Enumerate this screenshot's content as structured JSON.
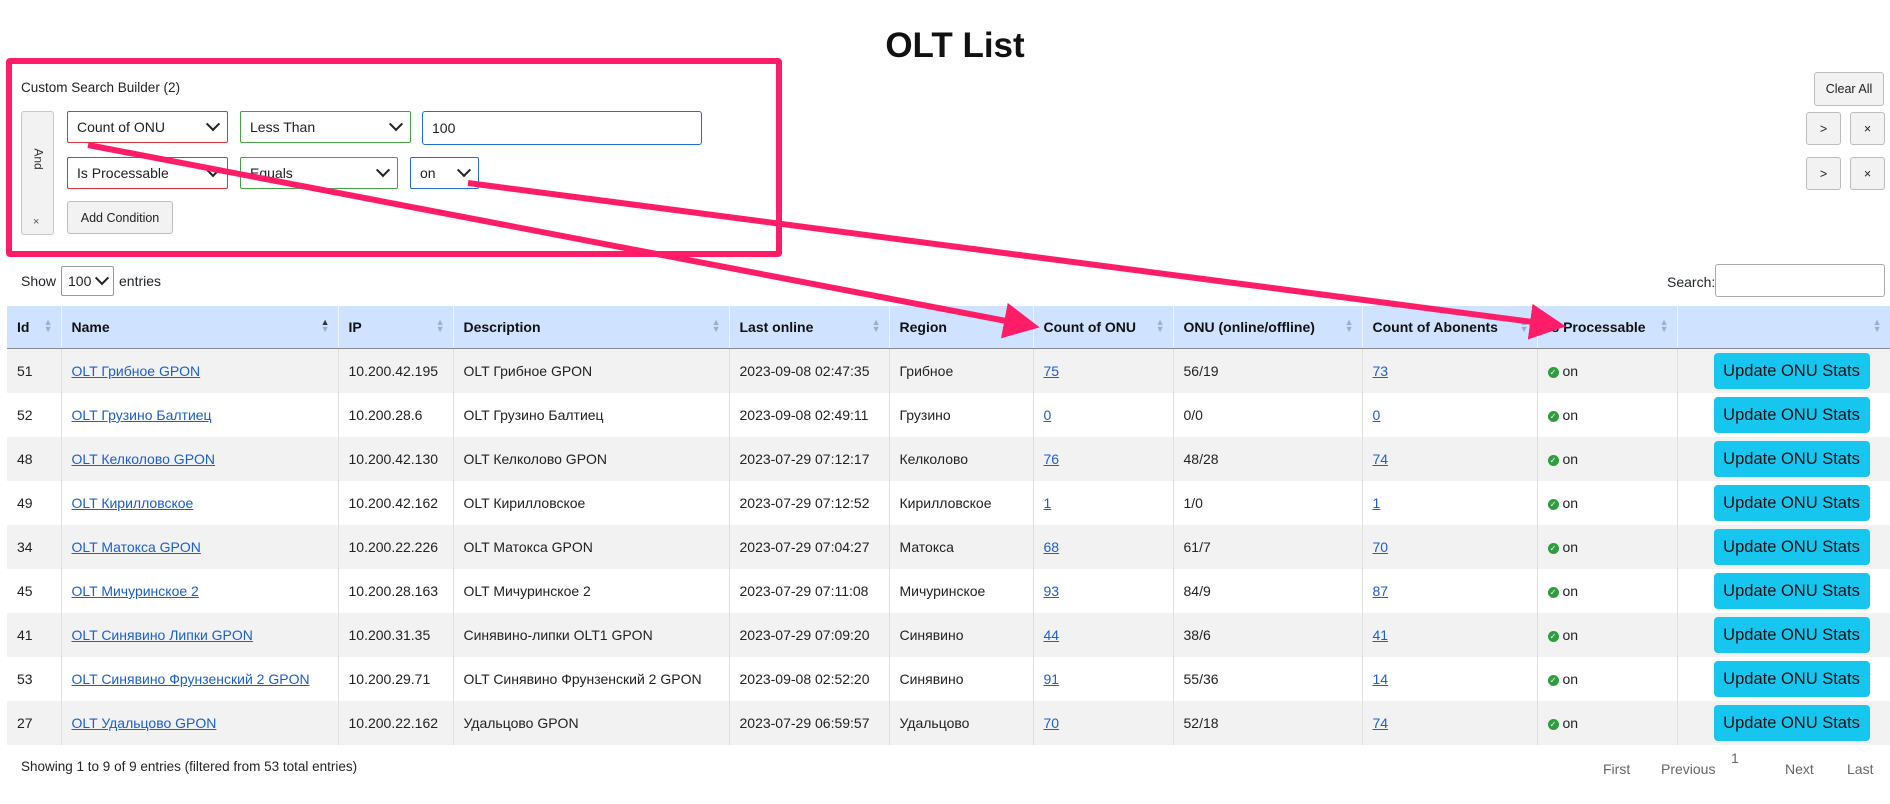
{
  "page": {
    "title": "OLT List"
  },
  "search_builder": {
    "title": "Custom Search Builder (2)",
    "logic": "And",
    "logic_remove": "×",
    "conditions": [
      {
        "column": "Count of ONU",
        "operator": "Less Than",
        "value": "100"
      },
      {
        "column": "Is Processable",
        "operator": "Equals",
        "value": "on"
      }
    ],
    "add_condition": "Add Condition",
    "clear_all": "Clear All",
    "indent_label": ">",
    "delete_label": "×"
  },
  "length": {
    "show": "Show",
    "value": "100",
    "entries": "entries"
  },
  "search": {
    "label": "Search:",
    "value": ""
  },
  "columns": [
    "Id",
    "Name",
    "IP",
    "Description",
    "Last online",
    "Region",
    "Count of ONU",
    "ONU (online/offline)",
    "Count of Abonents",
    "Is Processable",
    ""
  ],
  "rows": [
    {
      "id": "51",
      "name": "OLT Грибное GPON",
      "ip": "10.200.42.195",
      "desc": "OLT Грибное GPON",
      "last": "2023-09-08 02:47:35",
      "region": "Грибное",
      "onu": "75",
      "onu_status": "56/19",
      "abon": "73",
      "proc": "on",
      "action": "Update ONU Stats"
    },
    {
      "id": "52",
      "name": "OLT Грузино Балтиец",
      "ip": "10.200.28.6",
      "desc": "OLT Грузино Балтиец",
      "last": "2023-09-08 02:49:11",
      "region": "Грузино",
      "onu": "0",
      "onu_status": "0/0",
      "abon": "0",
      "proc": "on",
      "action": "Update ONU Stats"
    },
    {
      "id": "48",
      "name": "OLT Келколово GPON",
      "ip": "10.200.42.130",
      "desc": "OLT Келколово GPON",
      "last": "2023-07-29 07:12:17",
      "region": "Келколово",
      "onu": "76",
      "onu_status": "48/28",
      "abon": "74",
      "proc": "on",
      "action": "Update ONU Stats"
    },
    {
      "id": "49",
      "name": "OLT Кирилловское",
      "ip": "10.200.42.162",
      "desc": "OLT Кирилловское",
      "last": "2023-07-29 07:12:52",
      "region": "Кирилловское",
      "onu": "1",
      "onu_status": "1/0",
      "abon": "1",
      "proc": "on",
      "action": "Update ONU Stats"
    },
    {
      "id": "34",
      "name": "OLT Матокса GPON",
      "ip": "10.200.22.226",
      "desc": "OLT Матокса GPON",
      "last": "2023-07-29 07:04:27",
      "region": "Матокса",
      "onu": "68",
      "onu_status": "61/7",
      "abon": "70",
      "proc": "on",
      "action": "Update ONU Stats"
    },
    {
      "id": "45",
      "name": "OLT Мичуринское 2",
      "ip": "10.200.28.163",
      "desc": "OLT Мичуринское 2",
      "last": "2023-07-29 07:11:08",
      "region": "Мичуринское",
      "onu": "93",
      "onu_status": "84/9",
      "abon": "87",
      "proc": "on",
      "action": "Update ONU Stats"
    },
    {
      "id": "41",
      "name": "OLT Синявино Липки GPON",
      "ip": "10.200.31.35",
      "desc": "Синявино-липки OLT1 GPON",
      "last": "2023-07-29 07:09:20",
      "region": "Синявино",
      "onu": "44",
      "onu_status": "38/6",
      "abon": "41",
      "proc": "on",
      "action": "Update ONU Stats"
    },
    {
      "id": "53",
      "name": "OLT Синявино Фрунзенский 2 GPON",
      "ip": "10.200.29.71",
      "desc": "OLT Синявино Фрунзенский 2 GPON",
      "last": "2023-09-08 02:52:20",
      "region": "Синявино",
      "onu": "91",
      "onu_status": "55/36",
      "abon": "14",
      "proc": "on",
      "action": "Update ONU Stats"
    },
    {
      "id": "27",
      "name": "OLT Удальцово GPON",
      "ip": "10.200.22.162",
      "desc": "Удальцово GPON",
      "last": "2023-07-29 06:59:57",
      "region": "Удальцово",
      "onu": "70",
      "onu_status": "52/18",
      "abon": "74",
      "proc": "on",
      "action": "Update ONU Stats"
    }
  ],
  "info": "Showing 1 to 9 of 9 entries (filtered from 53 total entries)",
  "pagination": {
    "first": "First",
    "previous": "Previous",
    "current": "1",
    "next": "Next",
    "last": "Last"
  },
  "colors": {
    "highlight": "#ff1d67",
    "header_bg": "#cfe2ff",
    "button": "#17c6ef",
    "link": "#1a5fd1",
    "status": "#2e9e3e"
  }
}
